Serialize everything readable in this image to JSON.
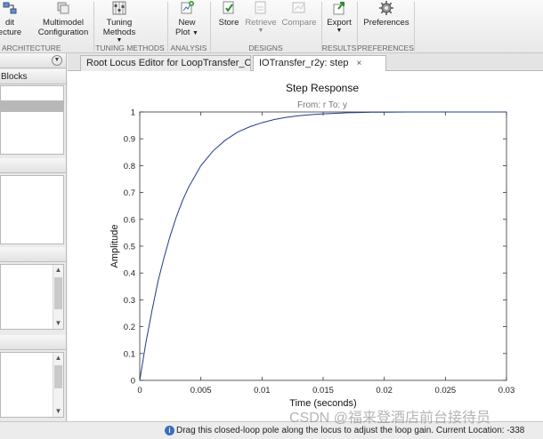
{
  "ribbon": {
    "buttons": [
      {
        "id": "edit",
        "label1": "dit",
        "label2": "ecture",
        "caret": false,
        "icon": "edit-architecture-icon"
      },
      {
        "id": "multimodel",
        "label1": "Multimodel",
        "label2": "Configuration",
        "caret": false,
        "icon": "multimodel-icon"
      },
      {
        "id": "tuning",
        "label1": "Tuning",
        "label2": "Methods",
        "caret": true,
        "icon": "tuning-methods-icon"
      },
      {
        "id": "newplot",
        "label1": "New",
        "label2": "Plot",
        "caret": true,
        "icon": "new-plot-icon"
      },
      {
        "id": "store",
        "label1": "Store",
        "label2": "",
        "caret": false,
        "icon": "store-icon"
      },
      {
        "id": "retrieve",
        "label1": "Retrieve",
        "label2": "",
        "caret": true,
        "icon": "retrieve-icon"
      },
      {
        "id": "compare",
        "label1": "Compare",
        "label2": "",
        "caret": false,
        "icon": "compare-icon"
      },
      {
        "id": "export",
        "label1": "Export",
        "label2": "",
        "caret": true,
        "icon": "export-icon"
      },
      {
        "id": "preferences",
        "label1": "Preferences",
        "label2": "",
        "caret": false,
        "icon": "gear-icon"
      }
    ],
    "sections": [
      "ARCHITECTURE",
      "TUNING METHODS",
      "ANALYSIS",
      "DESIGNS",
      "RESULTS",
      "PREFERENCES"
    ]
  },
  "left_panel": {
    "blocks_header": "Blocks"
  },
  "tabs": [
    {
      "label": "Root Locus Editor for LoopTransfer_C",
      "active": false
    },
    {
      "label": "IOTransfer_r2y: step",
      "active": true
    }
  ],
  "tab_close_glyph": "×",
  "status": {
    "text": "Drag this closed-loop pole along the locus to adjust the loop gain. Current Location: -338"
  },
  "watermark": "CSDN @福来登酒店前台接待员",
  "chart_data": {
    "type": "line",
    "title": "Step Response",
    "subtitle": "From: r  To: y",
    "xlabel": "Time (seconds)",
    "ylabel": "Amplitude",
    "xlim": [
      0,
      0.03
    ],
    "ylim": [
      0,
      1
    ],
    "xticks": [
      "0",
      "0.005",
      "0.01",
      "0.015",
      "0.02",
      "0.025",
      "0.03"
    ],
    "yticks": [
      "0",
      "0.1",
      "0.2",
      "0.3",
      "0.4",
      "0.5",
      "0.6",
      "0.7",
      "0.8",
      "0.9",
      "1"
    ],
    "grid": false,
    "line_color": "#1f3a8a",
    "series": [
      {
        "x": [
          0,
          0.0005,
          0.001,
          0.0015,
          0.002,
          0.0025,
          0.003,
          0.0035,
          0.004,
          0.0045,
          0.005,
          0.006,
          0.007,
          0.008,
          0.009,
          0.01,
          0.011,
          0.012,
          0.013,
          0.014,
          0.015,
          0.016,
          0.017,
          0.018,
          0.019,
          0.02,
          0.022,
          0.024,
          0.026,
          0.028,
          0.03
        ],
        "values": [
          0,
          0.14,
          0.26,
          0.37,
          0.46,
          0.54,
          0.61,
          0.67,
          0.72,
          0.76,
          0.8,
          0.855,
          0.895,
          0.925,
          0.945,
          0.96,
          0.972,
          0.98,
          0.986,
          0.99,
          0.993,
          0.995,
          0.997,
          0.998,
          0.999,
          0.999,
          1.0,
          1.0,
          1.0,
          1.0,
          1.0
        ]
      }
    ]
  }
}
